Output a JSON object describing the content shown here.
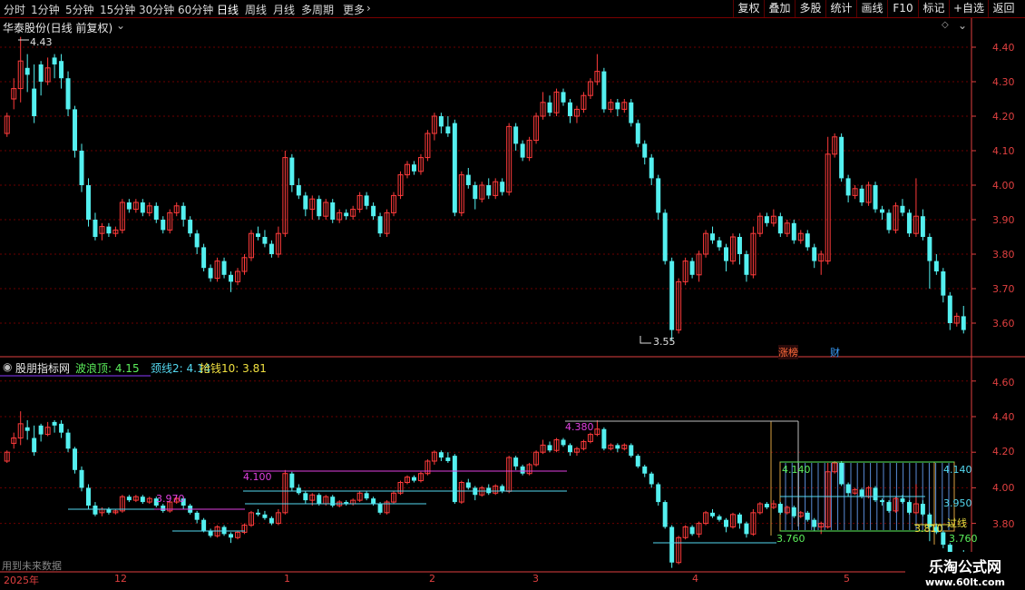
{
  "toolbar": {
    "timeframes": [
      "分时",
      "1分钟",
      "5分钟",
      "15分钟",
      "30分钟",
      "60分钟",
      "日线",
      "周线",
      "月线",
      "多周期",
      "更多"
    ],
    "active": "日线",
    "right_buttons": [
      "复权",
      "叠加",
      "多股",
      "统计",
      "画线",
      "F10",
      "标记",
      "+自选",
      "返回"
    ]
  },
  "main": {
    "title": "华泰股份(日线 前复权)",
    "high_label": "4.43",
    "low_label": "3.55",
    "yaxis": [
      "4.40",
      "4.30",
      "4.20",
      "4.10",
      "4.00",
      "3.90",
      "3.80",
      "3.70",
      "3.60"
    ],
    "badges": [
      "涨榜",
      "财"
    ]
  },
  "indicator": {
    "name": "股朋指标网",
    "wave_top_label": "波浪顶: 4.15",
    "neck_label": "颈线2: 4.14",
    "grab_label": "抢钱10: 3.81",
    "yaxis": [
      "4.60",
      "4.40",
      "4.20",
      "4.00",
      "3.80"
    ],
    "level_labels": [
      "3.970",
      "4.100",
      "4.380",
      "4.140",
      "3.950",
      "3.760",
      "3.810",
      "3.760"
    ],
    "guo_label": "过线",
    "footer_note": "用到未来数据"
  },
  "xaxis": {
    "labels": [
      "2025年",
      "12",
      "1",
      "2",
      "3",
      "4",
      "5"
    ]
  },
  "watermark": {
    "title": "乐淘公式网",
    "url": "www.60lt.com"
  },
  "colors": {
    "up": "#ff3b3b",
    "down": "#54f0f0",
    "grid": "#6b0000",
    "axis": "#e04040"
  },
  "chart_data": {
    "type": "candlestick",
    "ylim": [
      3.55,
      4.45
    ],
    "candles": [
      [
        4.15,
        4.2,
        4.21,
        4.14
      ],
      [
        4.25,
        4.28,
        4.31,
        4.22
      ],
      [
        4.28,
        4.36,
        4.43,
        4.24
      ],
      [
        4.34,
        4.32,
        4.38,
        4.27
      ],
      [
        4.28,
        4.2,
        4.35,
        4.18
      ],
      [
        4.35,
        4.3,
        4.36,
        4.26
      ],
      [
        4.3,
        4.34,
        4.37,
        4.29
      ],
      [
        4.37,
        4.35,
        4.38,
        4.31
      ],
      [
        4.36,
        4.31,
        4.38,
        4.28
      ],
      [
        4.31,
        4.22,
        4.33,
        4.2
      ],
      [
        4.22,
        4.1,
        4.23,
        4.08
      ],
      [
        4.1,
        4.0,
        4.12,
        3.98
      ],
      [
        4.0,
        3.9,
        4.02,
        3.88
      ],
      [
        3.9,
        3.85,
        3.92,
        3.84
      ],
      [
        3.86,
        3.88,
        3.89,
        3.84
      ],
      [
        3.88,
        3.86,
        3.89,
        3.85
      ],
      [
        3.86,
        3.87,
        3.88,
        3.85
      ],
      [
        3.87,
        3.95,
        3.96,
        3.86
      ],
      [
        3.95,
        3.93,
        3.96,
        3.92
      ],
      [
        3.93,
        3.95,
        3.96,
        3.92
      ],
      [
        3.95,
        3.92,
        3.96,
        3.91
      ],
      [
        3.92,
        3.94,
        3.95,
        3.91
      ],
      [
        3.94,
        3.9,
        3.95,
        3.89
      ],
      [
        3.9,
        3.87,
        3.91,
        3.86
      ],
      [
        3.87,
        3.92,
        3.93,
        3.86
      ],
      [
        3.92,
        3.94,
        3.95,
        3.91
      ],
      [
        3.94,
        3.9,
        3.95,
        3.88
      ],
      [
        3.9,
        3.86,
        3.91,
        3.85
      ],
      [
        3.86,
        3.82,
        3.87,
        3.8
      ],
      [
        3.82,
        3.76,
        3.83,
        3.75
      ],
      [
        3.76,
        3.73,
        3.77,
        3.72
      ],
      [
        3.73,
        3.78,
        3.79,
        3.72
      ],
      [
        3.78,
        3.74,
        3.79,
        3.73
      ],
      [
        3.74,
        3.72,
        3.75,
        3.69
      ],
      [
        3.72,
        3.75,
        3.76,
        3.71
      ],
      [
        3.75,
        3.79,
        3.8,
        3.74
      ],
      [
        3.79,
        3.86,
        3.87,
        3.78
      ],
      [
        3.86,
        3.85,
        3.88,
        3.84
      ],
      [
        3.85,
        3.83,
        3.87,
        3.82
      ],
      [
        3.83,
        3.8,
        3.84,
        3.79
      ],
      [
        3.8,
        3.86,
        3.88,
        3.79
      ],
      [
        3.86,
        4.08,
        4.1,
        3.85
      ],
      [
        4.08,
        4.0,
        4.09,
        3.98
      ],
      [
        4.0,
        3.97,
        4.02,
        3.96
      ],
      [
        3.97,
        3.93,
        3.98,
        3.91
      ],
      [
        3.93,
        3.96,
        3.97,
        3.9
      ],
      [
        3.96,
        3.91,
        3.97,
        3.9
      ],
      [
        3.91,
        3.95,
        3.96,
        3.9
      ],
      [
        3.95,
        3.9,
        3.96,
        3.89
      ],
      [
        3.9,
        3.92,
        3.93,
        3.89
      ],
      [
        3.92,
        3.91,
        3.93,
        3.9
      ],
      [
        3.91,
        3.93,
        3.94,
        3.9
      ],
      [
        3.93,
        3.97,
        3.98,
        3.92
      ],
      [
        3.97,
        3.94,
        3.98,
        3.93
      ],
      [
        3.94,
        3.91,
        3.95,
        3.9
      ],
      [
        3.91,
        3.86,
        3.92,
        3.85
      ],
      [
        3.86,
        3.92,
        3.93,
        3.85
      ],
      [
        3.92,
        3.97,
        3.98,
        3.91
      ],
      [
        3.97,
        4.03,
        4.04,
        3.96
      ],
      [
        4.03,
        4.06,
        4.07,
        4.02
      ],
      [
        4.06,
        4.04,
        4.07,
        4.03
      ],
      [
        4.04,
        4.08,
        4.09,
        4.03
      ],
      [
        4.08,
        4.15,
        4.16,
        4.07
      ],
      [
        4.15,
        4.2,
        4.21,
        4.13
      ],
      [
        4.2,
        4.17,
        4.21,
        4.15
      ],
      [
        4.17,
        4.15,
        4.2,
        4.14
      ],
      [
        4.18,
        3.92,
        4.19,
        3.91
      ],
      [
        3.92,
        4.03,
        4.04,
        3.91
      ],
      [
        4.03,
        4.0,
        4.05,
        3.99
      ],
      [
        4.0,
        3.96,
        4.01,
        3.93
      ],
      [
        3.96,
        4.0,
        4.01,
        3.95
      ],
      [
        4.0,
        3.97,
        4.02,
        3.96
      ],
      [
        3.97,
        4.01,
        4.02,
        3.96
      ],
      [
        4.01,
        3.98,
        4.02,
        3.97
      ],
      [
        3.98,
        4.17,
        4.18,
        3.97
      ],
      [
        4.17,
        4.12,
        4.18,
        4.1
      ],
      [
        4.12,
        4.08,
        4.13,
        4.07
      ],
      [
        4.08,
        4.13,
        4.14,
        4.07
      ],
      [
        4.13,
        4.2,
        4.21,
        4.12
      ],
      [
        4.2,
        4.24,
        4.27,
        4.19
      ],
      [
        4.24,
        4.21,
        4.26,
        4.2
      ],
      [
        4.21,
        4.27,
        4.28,
        4.2
      ],
      [
        4.27,
        4.24,
        4.28,
        4.23
      ],
      [
        4.24,
        4.2,
        4.25,
        4.18
      ],
      [
        4.2,
        4.22,
        4.23,
        4.18
      ],
      [
        4.22,
        4.26,
        4.27,
        4.21
      ],
      [
        4.26,
        4.3,
        4.31,
        4.25
      ],
      [
        4.3,
        4.33,
        4.38,
        4.29
      ],
      [
        4.33,
        4.22,
        4.34,
        4.21
      ],
      [
        4.22,
        4.24,
        4.25,
        4.21
      ],
      [
        4.24,
        4.22,
        4.25,
        4.2
      ],
      [
        4.22,
        4.24,
        4.25,
        4.21
      ],
      [
        4.24,
        4.18,
        4.25,
        4.17
      ],
      [
        4.18,
        4.12,
        4.19,
        4.11
      ],
      [
        4.12,
        4.08,
        4.13,
        4.06
      ],
      [
        4.08,
        4.02,
        4.09,
        4.0
      ],
      [
        4.02,
        3.92,
        4.03,
        3.9
      ],
      [
        3.92,
        3.78,
        3.93,
        3.77
      ],
      [
        3.78,
        3.58,
        3.79,
        3.55
      ],
      [
        3.58,
        3.72,
        3.73,
        3.57
      ],
      [
        3.72,
        3.78,
        3.79,
        3.71
      ],
      [
        3.78,
        3.74,
        3.79,
        3.73
      ],
      [
        3.74,
        3.8,
        3.81,
        3.72
      ],
      [
        3.8,
        3.86,
        3.87,
        3.79
      ],
      [
        3.86,
        3.84,
        3.88,
        3.83
      ],
      [
        3.84,
        3.82,
        3.85,
        3.81
      ],
      [
        3.82,
        3.78,
        3.83,
        3.75
      ],
      [
        3.78,
        3.85,
        3.86,
        3.77
      ],
      [
        3.85,
        3.8,
        3.86,
        3.77
      ],
      [
        3.8,
        3.74,
        3.81,
        3.72
      ],
      [
        3.74,
        3.86,
        3.88,
        3.73
      ],
      [
        3.86,
        3.91,
        3.92,
        3.85
      ],
      [
        3.91,
        3.89,
        3.92,
        3.88
      ],
      [
        3.89,
        3.91,
        3.93,
        3.88
      ],
      [
        3.91,
        3.86,
        3.92,
        3.85
      ],
      [
        3.86,
        3.89,
        3.9,
        3.85
      ],
      [
        3.89,
        3.84,
        3.9,
        3.83
      ],
      [
        3.84,
        3.86,
        3.87,
        3.83
      ],
      [
        3.86,
        3.82,
        3.87,
        3.81
      ],
      [
        3.82,
        3.78,
        3.83,
        3.76
      ],
      [
        3.78,
        3.8,
        3.81,
        3.74
      ],
      [
        3.78,
        4.09,
        4.14,
        3.77
      ],
      [
        4.09,
        4.14,
        4.15,
        4.08
      ],
      [
        4.14,
        4.02,
        4.15,
        4.01
      ],
      [
        4.02,
        3.97,
        4.03,
        3.95
      ],
      [
        3.97,
        3.99,
        4.0,
        3.96
      ],
      [
        3.99,
        3.95,
        4.0,
        3.94
      ],
      [
        3.95,
        4.0,
        4.01,
        3.94
      ],
      [
        4.0,
        3.93,
        4.01,
        3.92
      ],
      [
        3.93,
        3.92,
        3.94,
        3.9
      ],
      [
        3.92,
        3.87,
        3.93,
        3.86
      ],
      [
        3.87,
        3.94,
        3.95,
        3.86
      ],
      [
        3.94,
        3.92,
        3.96,
        3.91
      ],
      [
        3.92,
        3.86,
        3.93,
        3.85
      ],
      [
        3.86,
        3.91,
        4.02,
        3.85
      ],
      [
        3.91,
        3.85,
        3.93,
        3.84
      ],
      [
        3.85,
        3.78,
        3.86,
        3.7
      ],
      [
        3.78,
        3.75,
        3.8,
        3.74
      ],
      [
        3.75,
        3.68,
        3.76,
        3.66
      ],
      [
        3.68,
        3.6,
        3.69,
        3.58
      ],
      [
        3.6,
        3.62,
        3.63,
        3.59
      ],
      [
        3.62,
        3.58,
        3.65,
        3.57
      ]
    ]
  }
}
